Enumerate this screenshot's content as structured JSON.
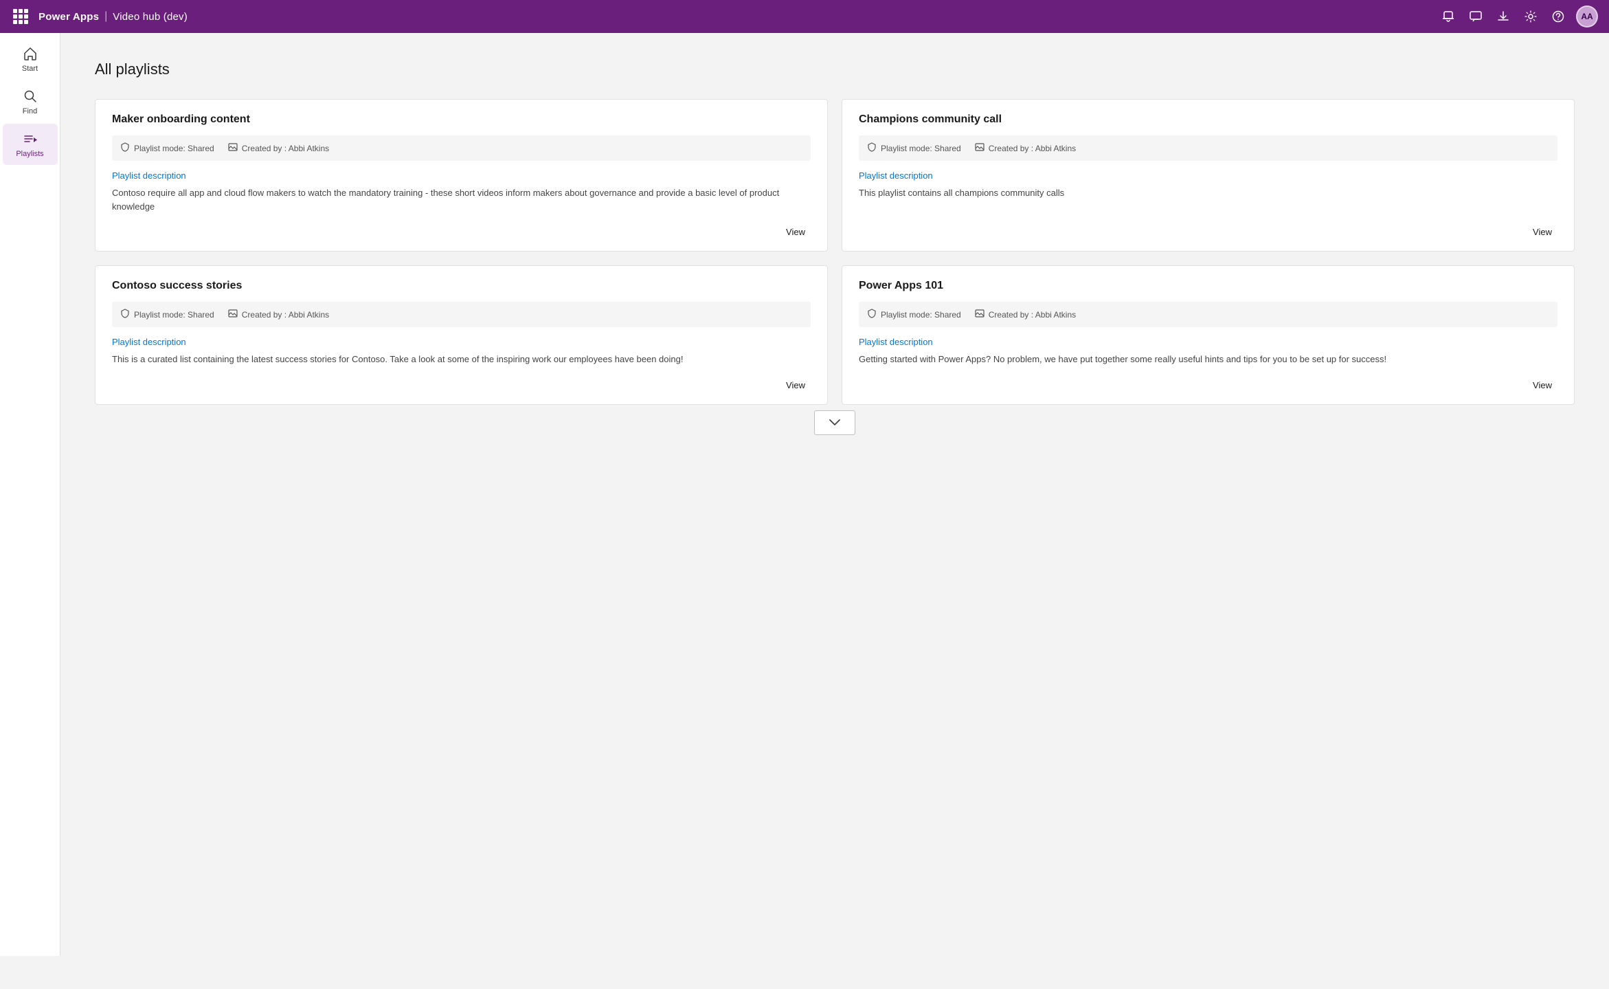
{
  "topnav": {
    "app_name": "Power Apps",
    "separator": "|",
    "subtitle": "Video hub (dev)",
    "avatar_initials": "AA"
  },
  "sidebar": {
    "items": [
      {
        "id": "start",
        "label": "Start",
        "icon": "🏠"
      },
      {
        "id": "find",
        "label": "Find",
        "icon": "🔍"
      },
      {
        "id": "playlists",
        "label": "Playlists",
        "icon": "≡"
      }
    ]
  },
  "main": {
    "page_title": "All playlists",
    "playlists": [
      {
        "id": "maker-onboarding",
        "title": "Maker onboarding content",
        "mode_label": "Playlist mode: Shared",
        "created_label": "Created by : Abbi Atkins",
        "desc_heading": "Playlist description",
        "description": "Contoso require all app and cloud flow makers to watch the mandatory training - these short videos inform makers about governance and provide a basic level of product knowledge",
        "view_label": "View"
      },
      {
        "id": "champions-community",
        "title": "Champions community call",
        "mode_label": "Playlist mode: Shared",
        "created_label": "Created by : Abbi Atkins",
        "desc_heading": "Playlist description",
        "description": "This playlist contains all champions community calls",
        "view_label": "View"
      },
      {
        "id": "contoso-success",
        "title": "Contoso success stories",
        "mode_label": "Playlist mode: Shared",
        "created_label": "Created by : Abbi Atkins",
        "desc_heading": "Playlist description",
        "description": "This is a curated list containing the latest success stories for Contoso.  Take a look at some of the inspiring work our employees have been doing!",
        "view_label": "View"
      },
      {
        "id": "power-apps-101",
        "title": "Power Apps 101",
        "mode_label": "Playlist mode: Shared",
        "created_label": "Created by : Abbi Atkins",
        "desc_heading": "Playlist description",
        "description": "Getting started with Power Apps?  No problem, we have put together some really useful hints and tips for you to be set up for success!",
        "view_label": "View"
      }
    ],
    "scroll_down_label": "⌄"
  }
}
